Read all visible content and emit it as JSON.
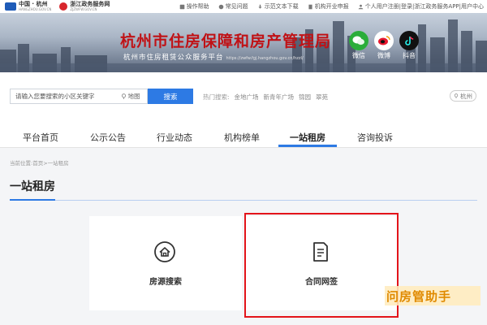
{
  "topbar": {
    "logo1": {
      "main": "中国 · 杭州",
      "sub": "HANGZHOU.GOV.CN"
    },
    "logo2": {
      "main": "浙江政务服务网",
      "sub": "ZJZWFW.GOV.CN"
    },
    "links": [
      {
        "label": "操作帮助",
        "icon": "help-icon"
      },
      {
        "label": "常见问题",
        "icon": "question-icon"
      },
      {
        "label": "示范文本下载",
        "icon": "download-icon"
      },
      {
        "label": "机构开业申报",
        "icon": "building-icon"
      },
      {
        "label": "个人用户注册|登录|浙江政务服务APP|用户中心",
        "icon": "user-icon"
      }
    ]
  },
  "banner": {
    "title": "杭州市住房保障和房产管理局",
    "subtitle": "杭州市住房租赁公众服务平台",
    "url": "https://zwfw.fgj.hangzhou.gov.cn/hzzl/",
    "social": [
      {
        "label": "微信",
        "icon": "wechat-icon",
        "color": "#2bad3a"
      },
      {
        "label": "微博",
        "icon": "weibo-icon",
        "color": "#e6162d"
      },
      {
        "label": "抖音",
        "icon": "douyin-icon",
        "color": "#111111"
      }
    ]
  },
  "search": {
    "placeholder": "请输入您要搜索的小区关键字",
    "map_label": "地图",
    "button_label": "搜索",
    "hot_label": "热门搜索:",
    "hot_items": [
      "金地广场",
      "新青年广场",
      "锦园",
      "翠苑"
    ],
    "city": "杭州"
  },
  "nav": {
    "items": [
      "平台首页",
      "公示公告",
      "行业动态",
      "机构榜单",
      "一站租房",
      "咨询投诉"
    ],
    "active_index": 4
  },
  "breadcrumb": "当前位置:首页>一站租房",
  "page_title": "一站租房",
  "cards": [
    {
      "label": "房源搜索",
      "icon": "house-search-icon"
    },
    {
      "label": "合同网签",
      "icon": "contract-icon"
    }
  ],
  "watermark": "问房管助手",
  "colors": {
    "accent": "#2d7ae4",
    "title_red": "#c01216",
    "highlight": "#e3141a"
  }
}
